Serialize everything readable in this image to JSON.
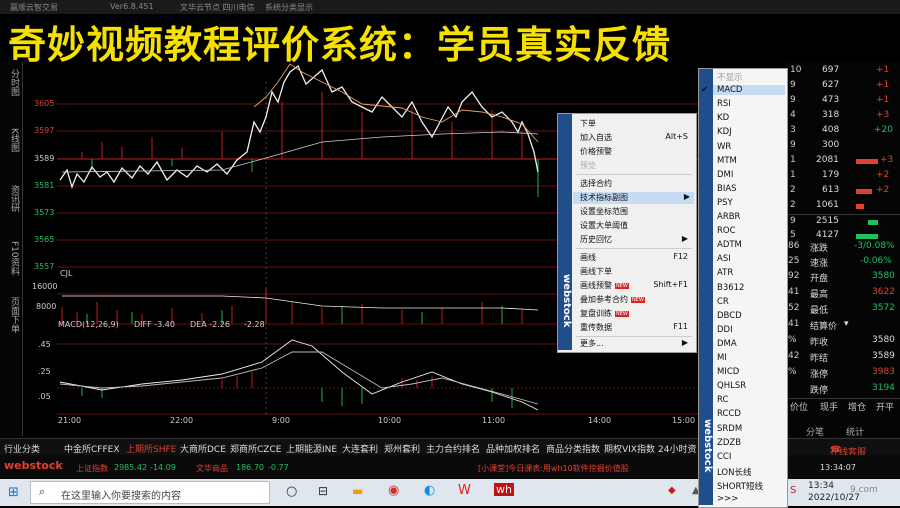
{
  "title_bar": {
    "app": "赢顺云智交易",
    "version": "Ver6.8.451",
    "node": "文华云节点 四川电信",
    "mode": "系统分类显示"
  },
  "banner": "奇妙视频教程评价系统：学员真实反馈",
  "left_tabs": [
    "分时图",
    "K线图",
    "资讯研",
    "F10资料",
    "页面下单"
  ],
  "price_axis": [
    "3605",
    "3597",
    "3589",
    "3581",
    "3573",
    "3565",
    "3557"
  ],
  "volume_axis": [
    "16000",
    "8000"
  ],
  "macd_axis": [
    ".45",
    ".25",
    ".05"
  ],
  "indicator_label": "CJL",
  "macd_header": {
    "label": "MACD(12,26,9)",
    "diff": "DIFF -3.40",
    "dea": "DEA -2.26",
    "macd": "-2.28"
  },
  "time_axis": [
    "21:00",
    "22:00",
    "9:00",
    "10:00",
    "11:00",
    "14:00",
    "15:00"
  ],
  "context_menu": {
    "brand": "webstock",
    "items": [
      {
        "label": "下单",
        "shortcut": ""
      },
      {
        "label": "加入自选",
        "shortcut": "Alt+S"
      },
      {
        "label": "价格预警",
        "shortcut": ""
      },
      {
        "label": "预览",
        "shortcut": ""
      },
      {
        "label": "选择合约",
        "shortcut": ""
      },
      {
        "label": "技术指标副图",
        "shortcut": "▶"
      },
      {
        "label": "设置坐标范围",
        "shortcut": ""
      },
      {
        "label": "设置大单阈值",
        "shortcut": ""
      },
      {
        "label": "历史回忆",
        "shortcut": "▶"
      },
      {
        "label": "画线",
        "shortcut": "F12"
      },
      {
        "label": "画线下单",
        "shortcut": ""
      },
      {
        "label": "画线预警",
        "shortcut": "Shift+F1"
      },
      {
        "label": "叠加参考合约",
        "shortcut": ""
      },
      {
        "label": "复盘训练",
        "shortcut": ""
      },
      {
        "label": "重传数据",
        "shortcut": "F11"
      },
      {
        "label": "更多...",
        "shortcut": "▶"
      }
    ],
    "new_badge": "NEW"
  },
  "submenu": {
    "brand": "webstock",
    "items": [
      "不显示",
      "MACD",
      "RSI",
      "KD",
      "KDJ",
      "WR",
      "MTM",
      "DMI",
      "BIAS",
      "PSY",
      "ARBR",
      "ROC",
      "ADTM",
      "ASI",
      "ATR",
      "B3612",
      "CR",
      "DBCD",
      "DDI",
      "DMA",
      "MI",
      "MICD",
      "QHLSR",
      "RC",
      "RCCD",
      "SRDM",
      "ZDZB",
      "CCI",
      "LON长线",
      "SHORT短线",
      ">>>"
    ],
    "checked": "✔"
  },
  "right_panel": {
    "rows": [
      {
        "a": "10",
        "b": "697",
        "c": "+1"
      },
      {
        "a": "9",
        "b": "627",
        "c": "+1"
      },
      {
        "a": "9",
        "b": "473",
        "c": "+1"
      },
      {
        "a": "4",
        "b": "318",
        "c": "+3"
      },
      {
        "a": "3",
        "b": "408",
        "c": "+20"
      },
      {
        "a": "9",
        "b": "300",
        "c": ""
      },
      {
        "a": "1",
        "b": "2081",
        "c": "+3"
      },
      {
        "a": "1",
        "b": "179",
        "c": "+2"
      },
      {
        "a": "2",
        "b": "613",
        "c": "+2"
      },
      {
        "a": "2",
        "b": "1061",
        "c": ""
      },
      {
        "a": "9",
        "b": "2515",
        "c": ""
      },
      {
        "a": "5",
        "b": "4127",
        "c": ""
      }
    ],
    "stats": [
      {
        "k": "涨跌",
        "v": "-3/0.08%",
        "p": "86"
      },
      {
        "k": "速涨",
        "v": "-0.06%",
        "p": "25"
      },
      {
        "k": "开盘",
        "v": "3580",
        "p": "92"
      },
      {
        "k": "最高",
        "v": "3622",
        "p": "41"
      },
      {
        "k": "最低",
        "v": "3572",
        "p": "52"
      },
      {
        "k": "结算价",
        "v": "",
        "p": "41"
      },
      {
        "k": "昨收",
        "v": "3580",
        "p": "%"
      },
      {
        "k": "昨结",
        "v": "3589",
        "p": "42"
      },
      {
        "k": "涨停",
        "v": "3983",
        "p": "%"
      },
      {
        "k": "跌停",
        "v": "3194",
        "p": ""
      }
    ],
    "footer": [
      "价位",
      "现手",
      "增仓",
      "开平"
    ],
    "extra": [
      "分笔",
      "统计"
    ]
  },
  "tabs_row": [
    "行业分类",
    "中金所CFFEX",
    "上期所SHFE",
    "大商所DCE",
    "郑商所CZCE",
    "上期能源INE",
    "大连套利",
    "郑州套利",
    "主力合约排名",
    "品种加权排名",
    "商品分类指数",
    "期权VIX指数",
    "24小时资"
  ],
  "service_button": "在线客服",
  "status_bar": {
    "brand": "webstock",
    "index_label": "上证指数",
    "index_value": "2985.42",
    "index_change": "-14.09",
    "commodity_label": "文华商品",
    "commodity_value": "186.70",
    "commodity_change": "-0.77",
    "news": "[小课堂]今日课表:用wh10软件挖掘价值股",
    "time": "13:34:07"
  },
  "taskbar": {
    "search_placeholder": "在这里输入你要搜索的内容",
    "time": "13:34",
    "date": "2022/10/27",
    "ime": "中",
    "watermark": "9.com"
  },
  "colors": {
    "up": "#e04030",
    "down": "#20c060",
    "banner": "#f5e000",
    "menu_strip": "#1f4e8a"
  }
}
